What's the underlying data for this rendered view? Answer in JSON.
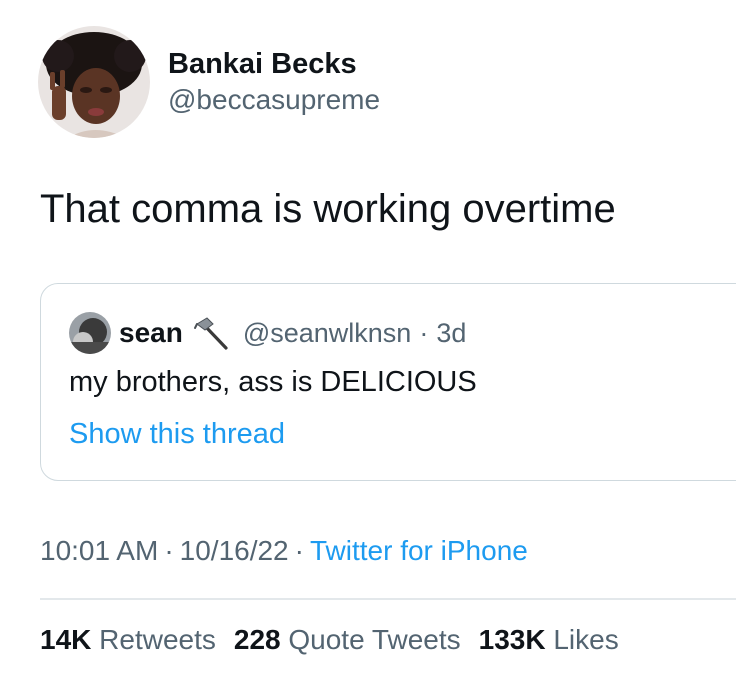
{
  "author": {
    "display_name": "Bankai Becks",
    "handle": "@beccasupreme"
  },
  "tweet": {
    "text": "That comma is working overtime"
  },
  "quote": {
    "name": "sean",
    "name_icon": "hammer-icon",
    "handle": "@seanwlknsn",
    "separator": "·",
    "time": "3d",
    "text": "my brothers, ass is DELICIOUS",
    "thread_link": "Show this thread"
  },
  "meta": {
    "time": "10:01 AM",
    "separator": "·",
    "date": "10/16/22",
    "source": "Twitter for iPhone"
  },
  "stats": {
    "retweets_count": "14K",
    "retweets_label": "Retweets",
    "quotes_count": "228",
    "quotes_label": "Quote Tweets",
    "likes_count": "133K",
    "likes_label": "Likes"
  },
  "colors": {
    "text": "#0f1419",
    "secondary": "#536471",
    "link": "#1d9bf0",
    "border": "#cfd9de"
  }
}
